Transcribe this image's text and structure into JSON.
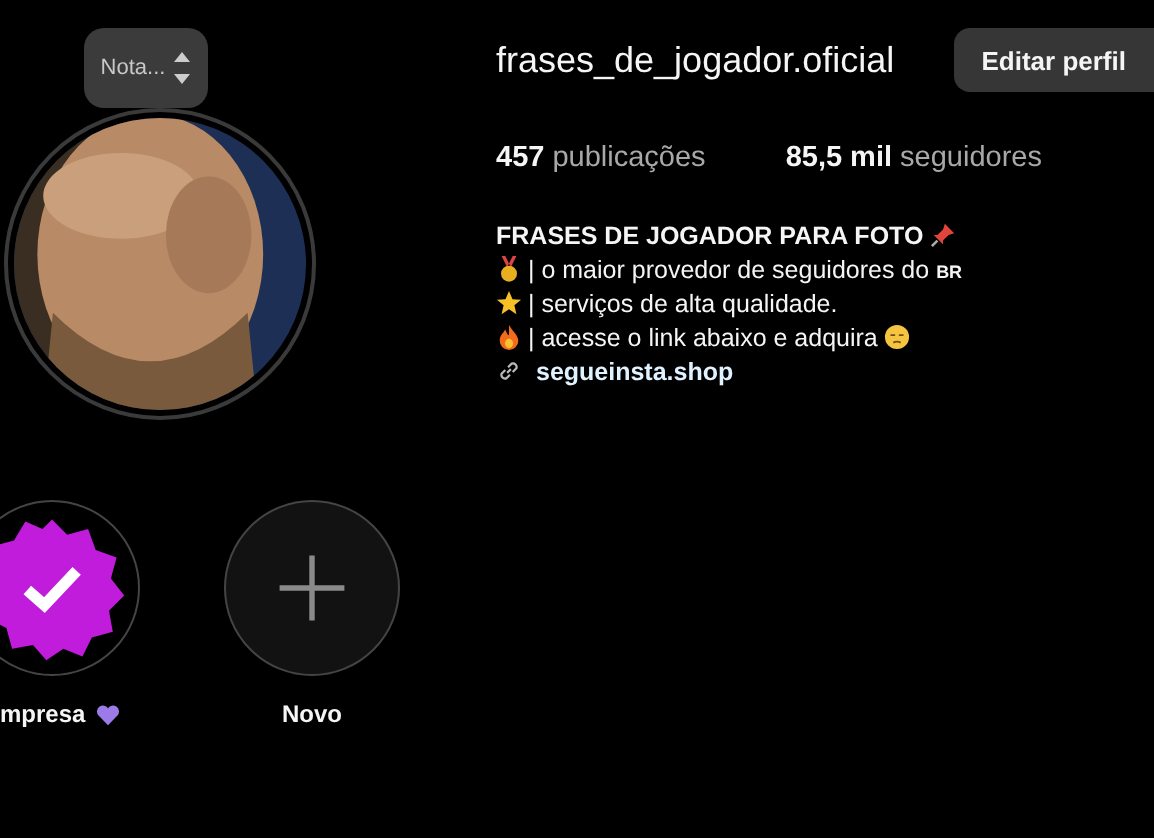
{
  "note": {
    "text": "Nota..."
  },
  "profile": {
    "username": "frases_de_jogador.oficial",
    "edit_button": "Editar perfil",
    "stats": [
      {
        "count": "457",
        "label": "publicações"
      },
      {
        "count": "85,5 mil",
        "label": "seguidores"
      }
    ]
  },
  "bio": [
    {
      "kind": "heading",
      "text": "FRASES DE JOGADOR PARA FOTO"
    },
    {
      "kind": "medal",
      "text": "| o maior provedor de seguidores do",
      "suffix": "BR"
    },
    {
      "kind": "star",
      "text": "| serviços de alta qualidade."
    },
    {
      "kind": "fire",
      "text": "| acesse o link abaixo e adquira"
    },
    {
      "kind": "link",
      "text": "segueinsta.shop"
    }
  ],
  "highlights": [
    {
      "kind": "badge",
      "label": "mpresa"
    },
    {
      "kind": "new",
      "label": "Novo"
    }
  ]
}
